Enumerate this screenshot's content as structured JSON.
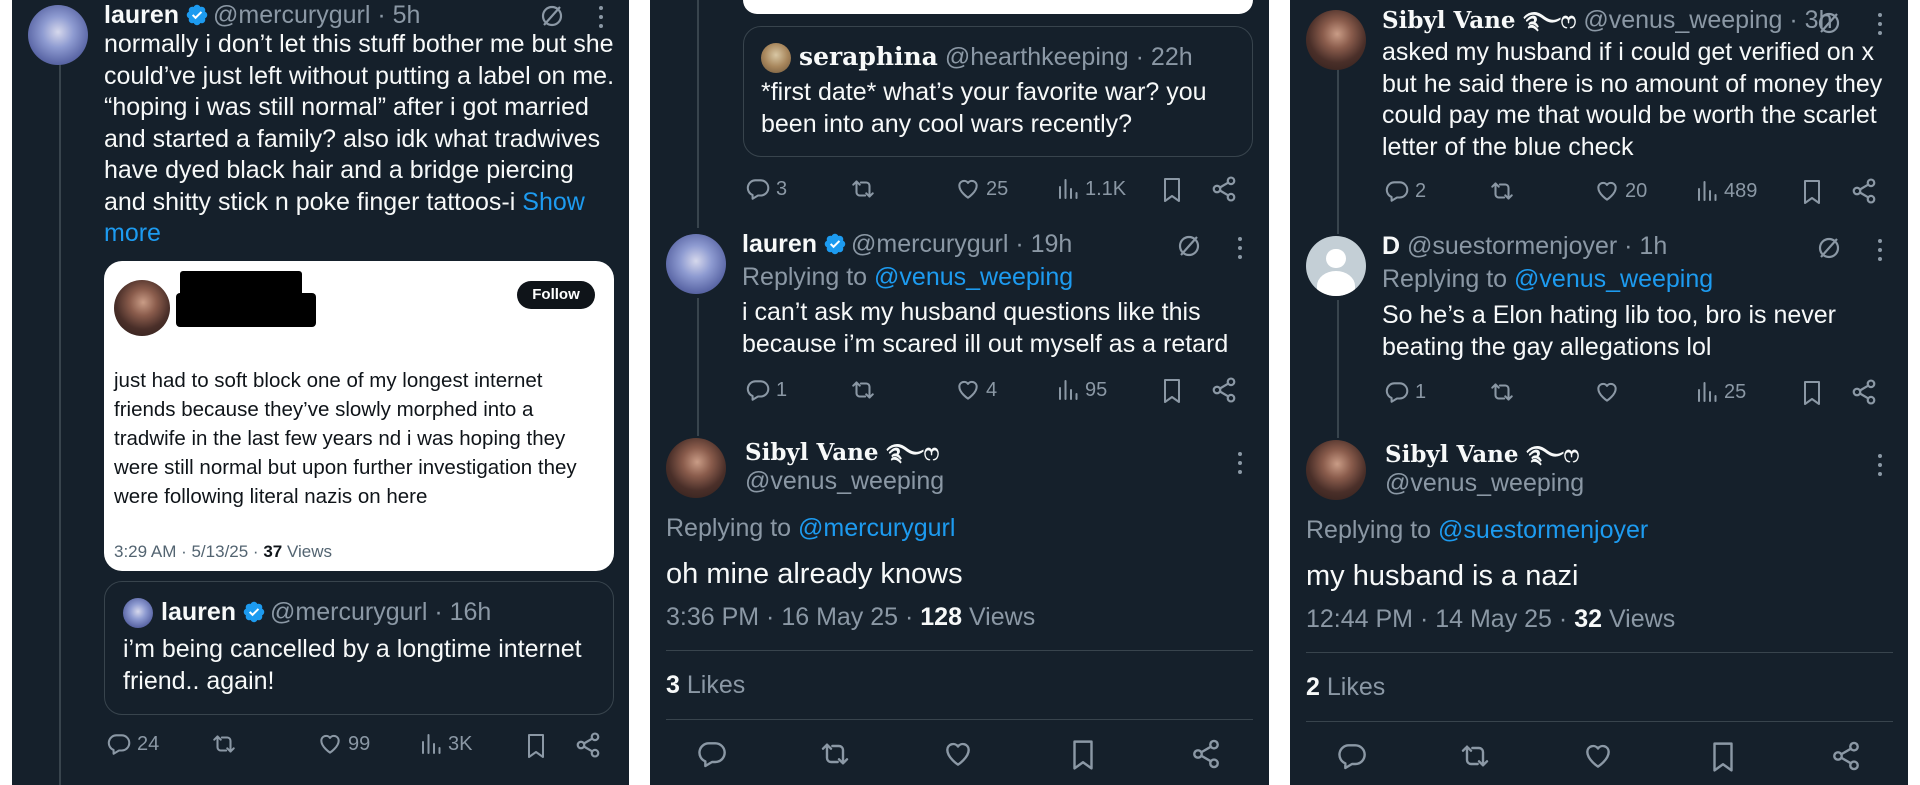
{
  "panel1": {
    "post": {
      "name": "lauren",
      "handle": "@mercurygurl",
      "time": "· 5h",
      "text": "normally i don’t let this stuff bother me but she could’ve just left without putting a label on me. “hoping i was still normal” after i got married and started a family? also idk what tradwives have dyed black hair and a bridge piercing and shitty stick n poke finger tattoos-i",
      "show_more": "Show more"
    },
    "screenshot_card": {
      "follow_label": "Follow",
      "text": "just had to soft block one of my longest internet friends because they’ve slowly morphed into a tradwife in the last few years nd i was hoping they were still normal but upon further investigation they were following literal nazis on here",
      "timestamp": "3:29 AM · 5/13/25 ·",
      "views_count": "37",
      "views_label": "Views"
    },
    "quote": {
      "name": "lauren",
      "handle": "@mercurygurl",
      "time": "· 16h",
      "text": "i’m being cancelled by a longtime internet friend.. again!"
    },
    "actions": {
      "replies": "24",
      "retweets": "",
      "likes": "99",
      "views": "3K"
    }
  },
  "panel2": {
    "quote": {
      "name": "seraphina",
      "handle": "@hearthkeeping",
      "time": "· 22h",
      "text": "*first date* what’s your favorite war? you been into any cool wars recently?"
    },
    "actions_top": {
      "replies": "3",
      "retweets": "",
      "likes": "25",
      "views": "1.1K"
    },
    "reply": {
      "name": "lauren",
      "handle": "@mercurygurl",
      "time": "· 19h",
      "replying_prefix": "Replying to",
      "replying_to": "@venus_weeping",
      "text": "i can’t ask my husband questions like this because i’m scared ill out myself as a retard"
    },
    "actions_reply": {
      "replies": "1",
      "retweets": "",
      "likes": "4",
      "views": "95"
    },
    "main": {
      "name": "Sibyl Vane ࿐ෆ",
      "handle": "@venus_weeping",
      "replying_prefix": "Replying to",
      "replying_to": "@mercurygurl",
      "text": "oh mine already knows",
      "timestamp": "3:36 PM · 16 May 25 ·",
      "views_count": "128",
      "views_label": "Views",
      "likes_count": "3",
      "likes_label": "Likes"
    }
  },
  "panel3": {
    "post": {
      "name": "Sibyl Vane ࿐ෆ",
      "handle": "@venus_weeping",
      "time": "· 3h",
      "text": "asked my husband if i could get verified on x but he said there is no amount of money they could pay me that would be worth the scarlet letter of the blue check"
    },
    "actions_top": {
      "replies": "2",
      "retweets": "",
      "likes": "20",
      "views": "489"
    },
    "reply": {
      "name": "D",
      "handle": "@suestormenjoyer",
      "time": "· 1h",
      "replying_prefix": "Replying to",
      "replying_to": "@venus_weeping",
      "text": "So he’s a Elon hating lib too, bro is never beating the gay allegations lol"
    },
    "actions_reply": {
      "replies": "1",
      "retweets": "",
      "likes": "",
      "views": "25"
    },
    "main": {
      "name": "Sibyl Vane ࿐ෆ",
      "handle": "@venus_weeping",
      "replying_prefix": "Replying to",
      "replying_to": "@suestormenjoyer",
      "text": "my husband is a nazi",
      "timestamp": "12:44 PM · 14 May 25 ·",
      "views_count": "32",
      "views_label": "Views",
      "likes_count": "2",
      "likes_label": "Likes"
    }
  },
  "icons": {
    "reply": "speech-bubble-icon",
    "retweet": "retweet-arrows-icon",
    "like": "heart-icon",
    "views": "bar-chart-icon",
    "bookmark": "bookmark-icon",
    "share": "share-nodes-icon",
    "grok": "grok-slash-circle-icon",
    "more": "vertical-ellipsis-icon",
    "verified": "verified-badge-icon"
  },
  "colors": {
    "background": "#15202b",
    "text": "#f7f9f9",
    "muted": "#8b98a5",
    "link": "#1d9bf0",
    "border": "#38444d",
    "verified": "#1d9bf0"
  }
}
